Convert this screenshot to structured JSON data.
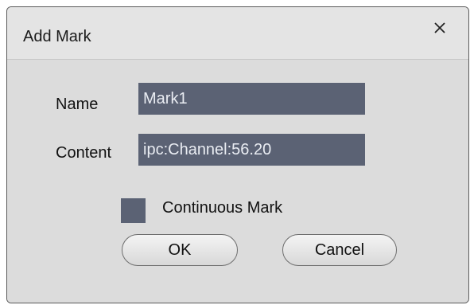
{
  "dialog": {
    "title": "Add Mark",
    "close_icon": "close-icon"
  },
  "form": {
    "name_label": "Name",
    "name_value": "Mark1",
    "content_label": "Content",
    "content_value": "ipc:Channel:56.20",
    "continuous_label": "Continuous Mark",
    "continuous_checked": false
  },
  "buttons": {
    "ok_label": "OK",
    "cancel_label": "Cancel"
  },
  "colors": {
    "field_bg": "#5b6274",
    "dialog_bg": "#dcdcdc"
  }
}
